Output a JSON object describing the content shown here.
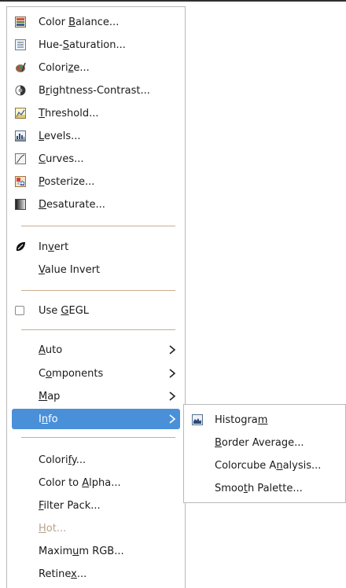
{
  "menu": {
    "items": [
      {
        "pre": "Color ",
        "acc": "B",
        "post": "alance...",
        "icon": "color-balance-icon"
      },
      {
        "pre": "Hue-",
        "acc": "S",
        "post": "aturation...",
        "icon": "hue-saturation-icon"
      },
      {
        "pre": "Colori",
        "acc": "z",
        "post": "e...",
        "icon": "colorize-icon"
      },
      {
        "pre": "B",
        "acc": "r",
        "post": "ightness-Contrast...",
        "icon": "brightness-contrast-icon"
      },
      {
        "pre": "",
        "acc": "T",
        "post": "hreshold...",
        "icon": "threshold-icon"
      },
      {
        "pre": "",
        "acc": "L",
        "post": "evels...",
        "icon": "levels-icon"
      },
      {
        "pre": "",
        "acc": "C",
        "post": "urves...",
        "icon": "curves-icon"
      },
      {
        "pre": "",
        "acc": "P",
        "post": "osterize...",
        "icon": "posterize-icon"
      },
      {
        "pre": "",
        "acc": "D",
        "post": "esaturate...",
        "icon": "desaturate-icon"
      }
    ],
    "invert": {
      "pre": "In",
      "acc": "v",
      "post": "ert",
      "icon": "invert-icon"
    },
    "value_invert": {
      "pre": "",
      "acc": "V",
      "post": "alue Invert"
    },
    "use_gegl": {
      "pre": "Use ",
      "acc": "G",
      "post": "EGL",
      "checked": false
    },
    "submenus": [
      {
        "pre": "",
        "acc": "A",
        "post": "uto"
      },
      {
        "pre": "C",
        "acc": "o",
        "post": "mponents"
      },
      {
        "pre": "",
        "acc": "M",
        "post": "ap"
      },
      {
        "pre": "I",
        "acc": "n",
        "post": "fo"
      }
    ],
    "plugins": [
      {
        "pre": "Colori",
        "acc": "f",
        "post": "y...",
        "disabled": false
      },
      {
        "pre": "Color to ",
        "acc": "A",
        "post": "lpha...",
        "disabled": false
      },
      {
        "pre": "",
        "acc": "F",
        "post": "ilter Pack...",
        "disabled": false
      },
      {
        "pre": "",
        "acc": "H",
        "post": "ot...",
        "disabled": true
      },
      {
        "pre": "Maxim",
        "acc": "u",
        "post": "m RGB...",
        "disabled": false
      },
      {
        "pre": "Retine",
        "acc": "x",
        "post": "...",
        "disabled": false
      }
    ]
  },
  "info_submenu": {
    "items": [
      {
        "pre": "Histogra",
        "acc": "m",
        "post": "",
        "icon": "histogram-icon"
      },
      {
        "pre": "",
        "acc": "B",
        "post": "order Average..."
      },
      {
        "pre": "Colorcube A",
        "acc": "n",
        "post": "alysis..."
      },
      {
        "pre": "Smoo",
        "acc": "t",
        "post": "h Palette..."
      }
    ]
  },
  "colors": {
    "highlight": "#4a90d9",
    "separator": "#c8ad8c",
    "disabled": "#b7a38b"
  }
}
